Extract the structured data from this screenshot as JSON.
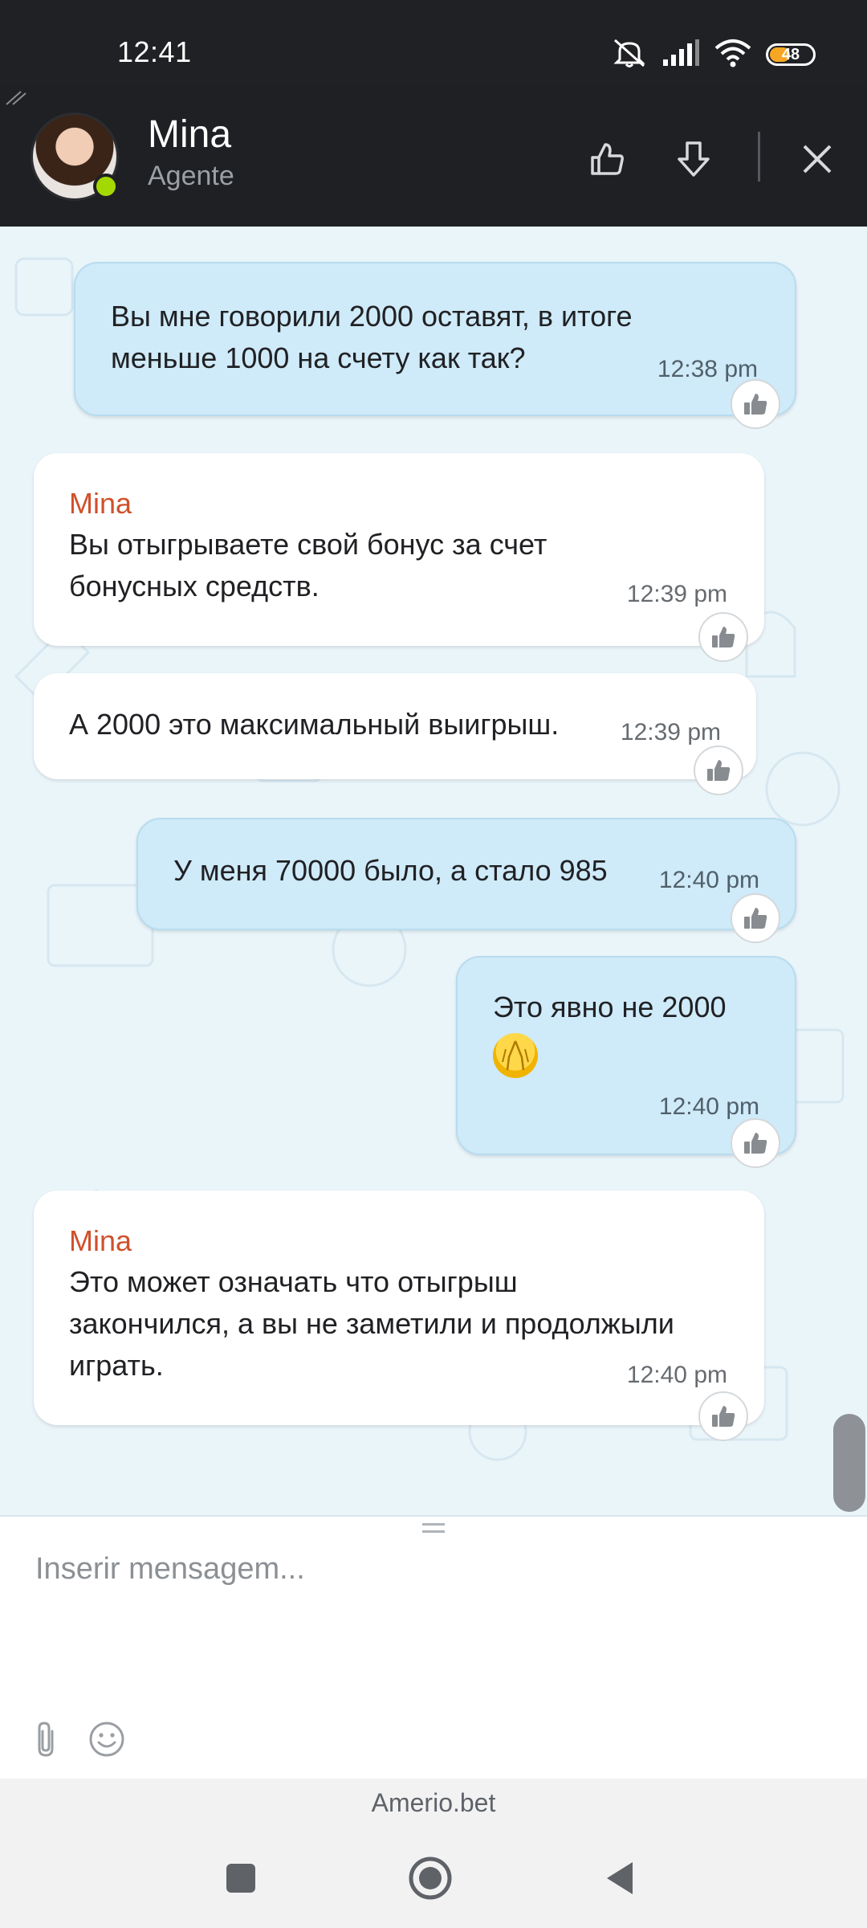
{
  "status_bar": {
    "time": "12:41",
    "battery": "48",
    "icons": [
      "mute-icon",
      "signal-icon",
      "wifi-icon",
      "battery-icon"
    ]
  },
  "header": {
    "agent_name": "Mina",
    "agent_role": "Agente",
    "online_color": "#a3d900",
    "actions": [
      "thumb-up-icon",
      "thumb-down-icon",
      "close-icon"
    ]
  },
  "messages": [
    {
      "direction": "out",
      "sender": "",
      "lines": [
        "Вы мне говорили 2000 оставят, в итоге",
        "меньше 1000 на счету как так?"
      ],
      "time": "12:38 pm"
    },
    {
      "direction": "in",
      "sender": "Mina",
      "lines": [
        "Вы отыгрываете свой бонус за счет",
        "бонусных средств."
      ],
      "time": "12:39 pm"
    },
    {
      "direction": "in",
      "sender": "",
      "lines": [
        "А 2000 это максимальный выигрыш."
      ],
      "time": "12:39 pm"
    },
    {
      "direction": "out",
      "sender": "",
      "lines": [
        "У меня 70000 было, а стало 985"
      ],
      "time": "12:40 pm"
    },
    {
      "direction": "out",
      "sender": "",
      "lines": [
        "Это явно не 2000"
      ],
      "emoji": "folded-hands-emoji",
      "time": "12:40 pm"
    },
    {
      "direction": "in",
      "sender": "Mina",
      "lines": [
        "Это может означать что отыгрыш",
        "закончился, а вы не заметили и продолжыли",
        "играть."
      ],
      "time": "12:40 pm"
    }
  ],
  "composer": {
    "placeholder": "Inserir mensagem...",
    "tools": [
      "attachment-icon",
      "emoji-icon"
    ]
  },
  "brand": "Amerio.bet",
  "nav": [
    "recents-icon",
    "home-icon",
    "back-icon"
  ],
  "colors": {
    "header_bg": "#1f2023",
    "outgoing_bubble": "#cfeaf8",
    "incoming_bubble": "#ffffff",
    "sender_name": "#d0502b",
    "chat_bg": "#eaf5fa"
  }
}
